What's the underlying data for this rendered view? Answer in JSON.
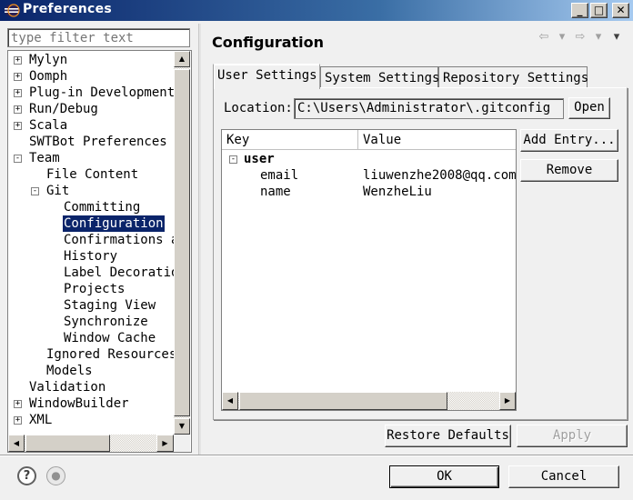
{
  "window": {
    "title": "Preferences",
    "minimize_label": "_",
    "maximize_label": "□",
    "close_label": "✕"
  },
  "filter": {
    "placeholder": "type filter text"
  },
  "tree": [
    {
      "label": "Mylyn",
      "indent": 0,
      "twisty": "+"
    },
    {
      "label": "Oomph",
      "indent": 0,
      "twisty": "+"
    },
    {
      "label": "Plug-in Development",
      "indent": 0,
      "twisty": "+"
    },
    {
      "label": "Run/Debug",
      "indent": 0,
      "twisty": "+"
    },
    {
      "label": "Scala",
      "indent": 0,
      "twisty": "+"
    },
    {
      "label": "SWTBot Preferences",
      "indent": 0,
      "twisty": ""
    },
    {
      "label": "Team",
      "indent": 0,
      "twisty": "-"
    },
    {
      "label": "File Content",
      "indent": 1,
      "twisty": ""
    },
    {
      "label": "Git",
      "indent": 1,
      "twisty": "-"
    },
    {
      "label": "Committing",
      "indent": 2,
      "twisty": ""
    },
    {
      "label": "Configuration",
      "indent": 2,
      "twisty": "",
      "selected": true
    },
    {
      "label": "Confirmations a",
      "indent": 2,
      "twisty": ""
    },
    {
      "label": "History",
      "indent": 2,
      "twisty": ""
    },
    {
      "label": "Label Decoratio",
      "indent": 2,
      "twisty": ""
    },
    {
      "label": "Projects",
      "indent": 2,
      "twisty": ""
    },
    {
      "label": "Staging View",
      "indent": 2,
      "twisty": ""
    },
    {
      "label": "Synchronize",
      "indent": 2,
      "twisty": ""
    },
    {
      "label": "Window Cache",
      "indent": 2,
      "twisty": ""
    },
    {
      "label": "Ignored Resources",
      "indent": 1,
      "twisty": ""
    },
    {
      "label": "Models",
      "indent": 1,
      "twisty": ""
    },
    {
      "label": "Validation",
      "indent": 0,
      "twisty": ""
    },
    {
      "label": "WindowBuilder",
      "indent": 0,
      "twisty": "+"
    },
    {
      "label": "XML",
      "indent": 0,
      "twisty": "+"
    }
  ],
  "page": {
    "title": "Configuration"
  },
  "tabs": [
    {
      "label": "User Settings",
      "active": true
    },
    {
      "label": "System Settings",
      "active": false
    },
    {
      "label": "Repository Settings",
      "active": false
    }
  ],
  "location": {
    "label": "Location:",
    "value": "C:\\Users\\Administrator\\.gitconfig",
    "open_label": "Open"
  },
  "table": {
    "col_key": "Key",
    "col_value": "Value",
    "section": "user",
    "section_twisty": "-",
    "rows": [
      {
        "key": "email",
        "value": "liuwenzhe2008@qq.com"
      },
      {
        "key": "name",
        "value": "WenzheLiu"
      }
    ]
  },
  "side_buttons": {
    "add_entry": "Add Entry...",
    "remove": "Remove"
  },
  "page_buttons": {
    "restore_defaults": "Restore Defaults",
    "apply": "Apply"
  },
  "dialog_buttons": {
    "ok": "OK",
    "cancel": "Cancel"
  },
  "icons": {
    "back": "⇦",
    "forward": "⇨",
    "dropdown": "▾",
    "menu": "▾",
    "help": "?",
    "record": "●",
    "scroll_up": "▲",
    "scroll_down": "▼",
    "scroll_left": "◀",
    "scroll_right": "▶"
  }
}
